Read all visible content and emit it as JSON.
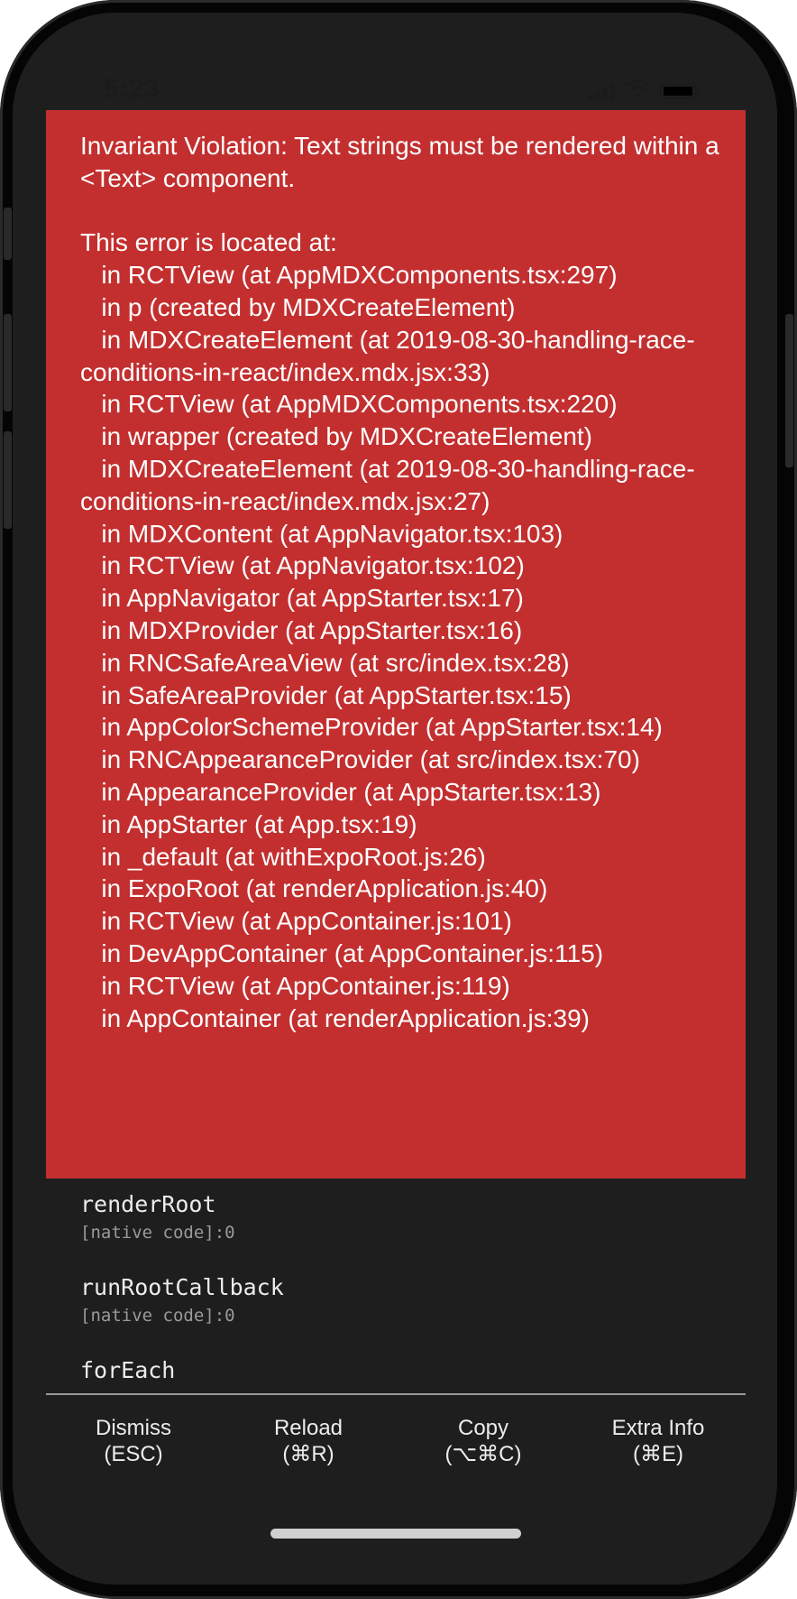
{
  "status_bar": {
    "time": "5:23",
    "icons": [
      "signal-icon",
      "wifi-icon",
      "battery-icon"
    ]
  },
  "error": {
    "title": "Invariant Violation: Text strings must be rendered within a <Text> component.",
    "located_label": "This error is located at:",
    "stack": [
      "   in RCTView (at AppMDXComponents.tsx:297)",
      "   in p (created by MDXCreateElement)",
      "   in MDXCreateElement (at 2019-08-30-handling-race-conditions-in-react/index.mdx.jsx:33)",
      "   in RCTView (at AppMDXComponents.tsx:220)",
      "   in wrapper (created by MDXCreateElement)",
      "   in MDXCreateElement (at 2019-08-30-handling-race-conditions-in-react/index.mdx.jsx:27)",
      "   in MDXContent (at AppNavigator.tsx:103)",
      "   in RCTView (at AppNavigator.tsx:102)",
      "   in AppNavigator (at AppStarter.tsx:17)",
      "   in MDXProvider (at AppStarter.tsx:16)",
      "   in RNCSafeAreaView (at src/index.tsx:28)",
      "   in SafeAreaProvider (at AppStarter.tsx:15)",
      "   in AppColorSchemeProvider (at AppStarter.tsx:14)",
      "   in RNCAppearanceProvider (at src/index.tsx:70)",
      "   in AppearanceProvider (at AppStarter.tsx:13)",
      "   in AppStarter (at App.tsx:19)",
      "   in _default (at withExpoRoot.js:26)",
      "   in ExpoRoot (at renderApplication.js:40)",
      "   in RCTView (at AppContainer.js:101)",
      "   in DevAppContainer (at AppContainer.js:115)",
      "   in RCTView (at AppContainer.js:119)",
      "   in AppContainer (at renderApplication.js:39)"
    ]
  },
  "call_stack": [
    {
      "method": "renderRoot",
      "location": "[native code]:0"
    },
    {
      "method": "runRootCallback",
      "location": "[native code]:0"
    },
    {
      "method": "forEach",
      "location": ""
    }
  ],
  "actions": [
    {
      "label": "Dismiss",
      "shortcut": "(ESC)"
    },
    {
      "label": "Reload",
      "shortcut": "(⌘R)"
    },
    {
      "label": "Copy",
      "shortcut": "(⌥⌘C)"
    },
    {
      "label": "Extra Info",
      "shortcut": "(⌘E)"
    }
  ],
  "colors": {
    "error_background": "#c32f2f",
    "screen_background": "#1e1e1e",
    "text": "#ffffff",
    "muted_text": "#9a9a9a"
  }
}
